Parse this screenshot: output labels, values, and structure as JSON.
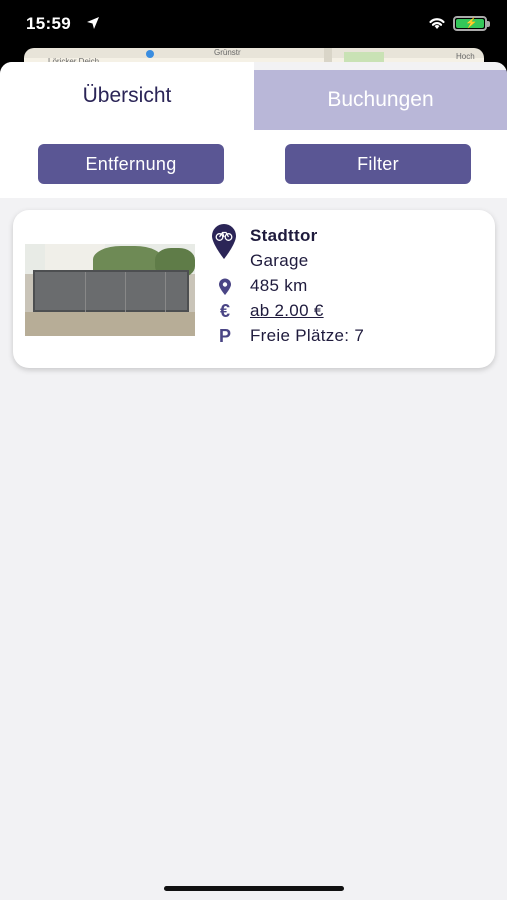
{
  "status_bar": {
    "time": "15:59"
  },
  "map": {
    "label_left": "Löricker Deich",
    "label_top": "Grünstr",
    "label_right": "Hoch Düs"
  },
  "tabs": [
    {
      "label": "Übersicht",
      "active": true
    },
    {
      "label": "Buchungen",
      "active": false
    }
  ],
  "controls": {
    "distance_label": "Entfernung",
    "filter_label": "Filter"
  },
  "listing": {
    "name": "Stadttor",
    "type": "Garage",
    "distance": "485 km",
    "price": "ab 2.00 €",
    "free_spots": "Freie Plätze: 7"
  },
  "colors": {
    "accent": "#5a5694",
    "tab_inactive": "#b9b7d8",
    "text_dark": "#1f1b3d"
  }
}
